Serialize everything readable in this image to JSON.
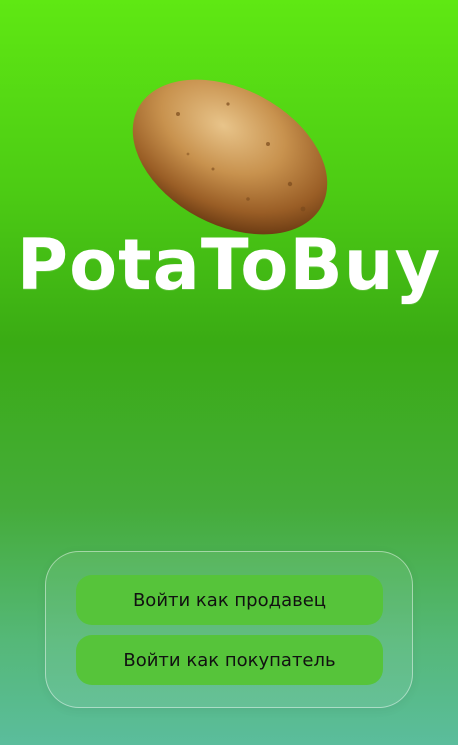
{
  "app": {
    "logo_text": "PotaToBuy"
  },
  "colors": {
    "gradient_top": "#5fe813",
    "gradient_middle": "#3aab14",
    "gradient_bottom": "#5bbd9c",
    "button_fill": "#56c43a",
    "text_white": "#ffffff"
  },
  "hero": {
    "image": "potato-illustration"
  },
  "actions": {
    "seller_label": "Войти как продавец",
    "buyer_label": "Войти как покупатель"
  }
}
